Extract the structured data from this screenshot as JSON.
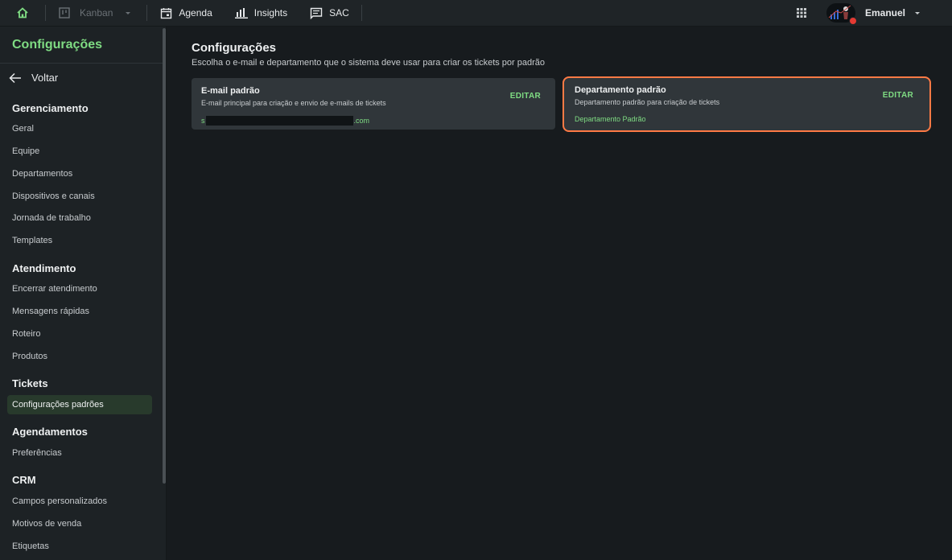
{
  "topbar": {
    "kanban_label": "Kanban",
    "agenda_label": "Agenda",
    "insights_label": "Insights",
    "sac_label": "SAC",
    "user_name": "Emanuel"
  },
  "sidebar": {
    "title": "Configurações",
    "back_label": "Voltar",
    "sections": {
      "gerenciamento": "Gerenciamento",
      "atendimento": "Atendimento",
      "tickets": "Tickets",
      "agendamentos": "Agendamentos",
      "crm": "CRM"
    },
    "links": {
      "geral": "Geral",
      "equipe": "Equipe",
      "departamentos": "Departamentos",
      "dispositivos": "Dispositivos e canais",
      "jornada": "Jornada de trabalho",
      "templates": "Templates",
      "encerrar": "Encerrar atendimento",
      "mensagens": "Mensagens rápidas",
      "roteiro": "Roteiro",
      "produtos": "Produtos",
      "config_padroes": "Configurações padrões",
      "preferencias": "Preferências",
      "campos": "Campos personalizados",
      "motivos": "Motivos de venda",
      "etiquetas": "Etiquetas"
    }
  },
  "main": {
    "title": "Configurações",
    "subtitle": "Escolha o e-mail e departamento que o sistema deve usar para criar os tickets por padrão",
    "email_card": {
      "title": "E-mail padrão",
      "description": "E-mail principal para criação e envio de e-mails de tickets",
      "value_start": "s",
      "value_end": ".com",
      "edit_label": "EDITAR"
    },
    "department_card": {
      "title": "Departamento padrão",
      "description": "Departamento padrão para criação de tickets",
      "value": "Departamento Padrão",
      "edit_label": "EDITAR"
    }
  },
  "colors": {
    "accent_green": "#7fdc83",
    "highlight_orange": "#ff7a45",
    "notification_red": "#e43a33"
  }
}
